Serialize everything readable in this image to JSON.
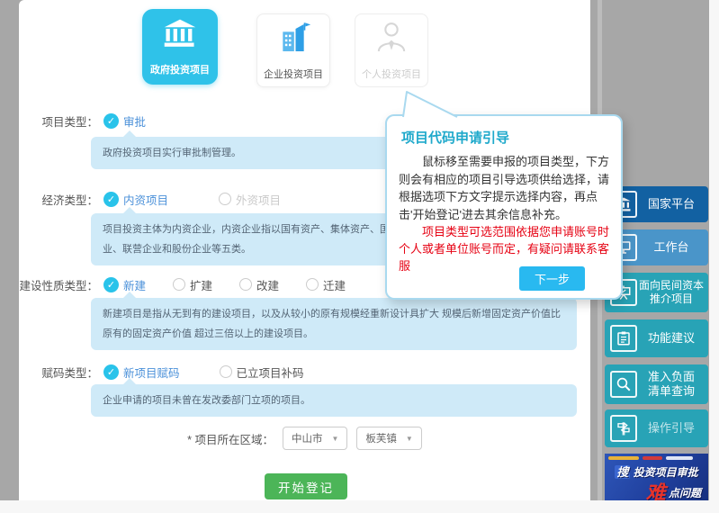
{
  "icons": {
    "check": "✓",
    "caret_down": "▼"
  },
  "cards": {
    "government": {
      "label": "政府投资项目"
    },
    "enterprise": {
      "label": "企业投资项目"
    },
    "personal": {
      "label": "个人投资项目"
    }
  },
  "form": {
    "rows": {
      "project_type": {
        "label": "项目类型：",
        "checked_option": "审批",
        "info": "政府投资项目实行审批制管理。"
      },
      "economic_type": {
        "label": "经济类型：",
        "checked_option": "内资项目",
        "disabled_option": "外资项目",
        "info_line1": "项目投资主体为内资企业，内资企业指以国有资产、集体资产、国内个人资产",
        "info_line2": "业、联营企业和股份企业等五类。"
      },
      "construction_type": {
        "label": "建设性质类型：",
        "checked_option": "新建",
        "option2": "扩建",
        "option3": "改建",
        "option4": "迁建",
        "info": "新建项目是指从无到有的建设项目，以及从较小的原有规模经重新设计具扩大 规模后新增固定资产价值比原有的固定资产价值 超过三倍以上的建设项目。"
      },
      "coding_type": {
        "label": "赋码类型：",
        "checked_option": "新项目赋码",
        "option2": "已立项目补码",
        "info": "企业申请的项目未曾在发改委部门立项的项目。"
      }
    },
    "region": {
      "label": "* 项目所在区域：",
      "city": "中山市",
      "town": "板芙镇"
    },
    "submit_label": "开始登记"
  },
  "popup": {
    "title": "项目代码申请引导",
    "body": "鼠标移至需要申报的项目类型，下方则会有相应的项目引导选项供给选择，请根据选项下方文字提示选择内容，再点击'开始登记'进去其余信息补充。",
    "warning": "项目类型可选范围依据您申请账号时个人或者单位账号而定，有疑问请联系客服",
    "next_label": "下一步"
  },
  "sidebar": {
    "items": [
      {
        "label": "国家平台",
        "icon": "bank-icon",
        "color": "#1261a2"
      },
      {
        "label": "工作台",
        "icon": "workbench-icon",
        "color": "#4a95c9"
      },
      {
        "label": "面向民间资本\n推介项目",
        "icon": "promote-icon",
        "color": "#28a3b6"
      },
      {
        "label": "功能建议",
        "icon": "suggestion-icon",
        "color": "#28a3b6"
      },
      {
        "label": "准入负面\n清单查询",
        "icon": "search-icon",
        "color": "#28a3b6"
      },
      {
        "label": "操作引导",
        "icon": "signpost-icon",
        "color": "#28a3b6"
      }
    ],
    "banner": {
      "prefix": "搜",
      "line1": "投资项目审批",
      "highlight": "难",
      "line2": "点问题"
    }
  },
  "colors": {
    "selected_card_cyan": "#2fc2e9",
    "link_blue": "#4a90d9",
    "check_cyan": "#29c3ea",
    "bubble_blue": "#cfeaf8",
    "popup_title_teal": "#1fa9cb",
    "warning_red": "#e60012",
    "next_button_blue": "#29b9f0",
    "submit_green": "#4cb558",
    "overlay_gray": "#a7a7a7"
  }
}
